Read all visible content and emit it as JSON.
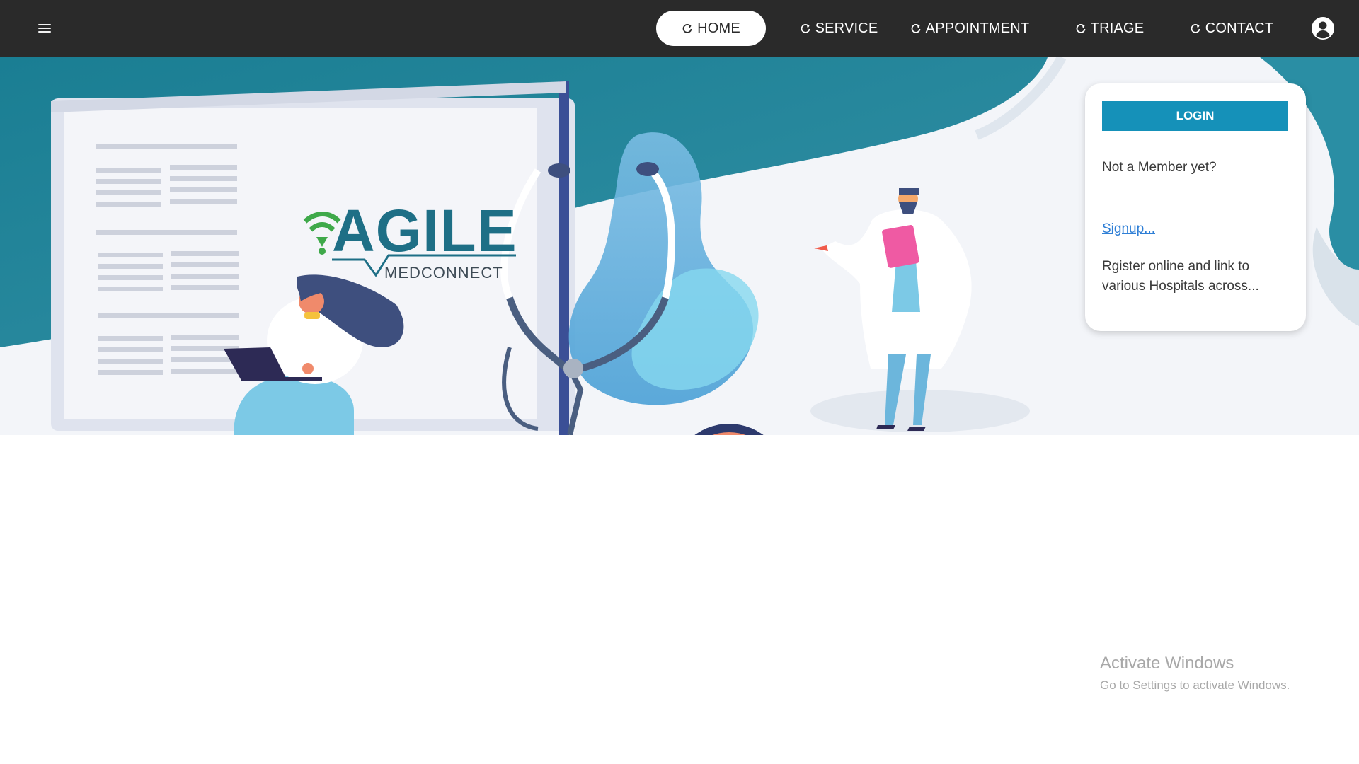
{
  "nav": {
    "menu_icon": "hamburger-icon",
    "items": [
      {
        "label": "HOME",
        "icon": "refresh-icon",
        "active": true
      },
      {
        "label": "SERVICE",
        "icon": "refresh-icon",
        "active": false
      },
      {
        "label": "APPOINTMENT",
        "icon": "refresh-icon",
        "active": false
      },
      {
        "label": "TRIAGE",
        "icon": "refresh-icon",
        "active": false
      },
      {
        "label": "CONTACT",
        "icon": "refresh-icon",
        "active": false
      }
    ],
    "user_icon": "account-circle-icon"
  },
  "hero": {
    "logo_text": "AGILE",
    "logo_subtext": "MEDCONNECT"
  },
  "login_card": {
    "login_label": "LOGIN",
    "not_member_text": "Not a Member yet?",
    "signup_link": "Signup...",
    "register_text": "Rgister online and link to various Hospitals across..."
  },
  "watermark": {
    "title": "Activate Windows",
    "subtitle": "Go to Settings to activate Windows."
  },
  "colors": {
    "topbar": "#2a2a2a",
    "teal": "#1e7f96",
    "login_button": "#1591b9",
    "link": "#2f7fd6"
  }
}
